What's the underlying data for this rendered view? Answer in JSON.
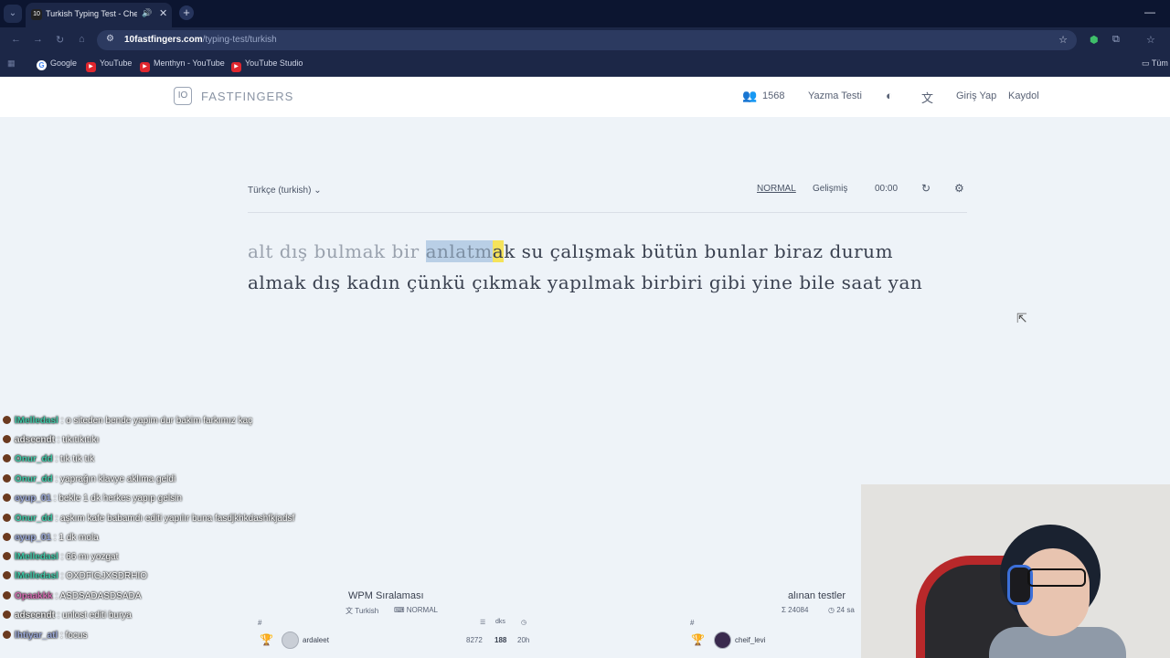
{
  "browser": {
    "tab_title": "Turkish Typing Test - Check",
    "url_host": "10fastfingers.com",
    "url_path": "/typing-test/turkish",
    "bookmarks": [
      "Google",
      "YouTube",
      "Menthyn - YouTube",
      "YouTube Studio",
      "Tüm"
    ]
  },
  "site": {
    "logo_text": "FASTFINGERS",
    "logo_mark": "IO",
    "online_count": "1568",
    "nav_typing_test": "Yazma Testi",
    "nav_login": "Giriş Yap",
    "nav_signup": "Kaydol"
  },
  "test": {
    "language": "Türkçe (turkish)",
    "mode_normal": "NORMAL",
    "mode_advanced": "Gelişmiş",
    "timer": "00:00",
    "line1_typed": "alt dış bulmak bir ",
    "current_word_typed": "anlatm",
    "current_word_caret": "a",
    "current_word_rest": "k",
    "line1_rest": " su çalışmak bütün bunlar biraz durum",
    "line2": "almak dış kadın çünkü çıkmak yapılmak birbiri gibi yine bile saat yan"
  },
  "chat": [
    {
      "nick": "lMelledasl",
      "text": " : o siteden bende yapim dur bakim farkımız kaç",
      "color": "#3ec9a7"
    },
    {
      "nick": "adsecndt",
      "text": " : tıkıtıkıtıkı",
      "color": "#e8e8e8"
    },
    {
      "nick": "Onur_dd",
      "text": " : tık tık tık",
      "color": "#3ec9a7"
    },
    {
      "nick": "Onur_dd",
      "text": " : yaprağın klavye aklıma geldi",
      "color": "#3ec9a7"
    },
    {
      "nick": "eyup_01",
      "text": " : bekle 1 dk herkes yapıp gelsin",
      "color": "#9aa8d8"
    },
    {
      "nick": "Onur_dd",
      "text": " : aşkım kafe babamdı editi yapılır buna fasdjkhkdashfkjadsf",
      "color": "#3ec9a7"
    },
    {
      "nick": "eyup_01",
      "text": " : 1 dk mola",
      "color": "#9aa8d8"
    },
    {
      "nick": "lMelledasl",
      "text": " : 66 mı yozgat",
      "color": "#3ec9a7"
    },
    {
      "nick": "lMelledasl",
      "text": " : OXDFIGJXSDRHIO",
      "color": "#3ec9a7"
    },
    {
      "nick": "Opaakkk",
      "text": " : ASDSADASDSADA",
      "color": "#d46bb0"
    },
    {
      "nick": "adsecndt",
      "text": " : unlost editi burya",
      "color": "#e8e8e8"
    },
    {
      "nick": "lhtiyar_atl",
      "text": " : focus",
      "color": "#9aa8d8"
    }
  ],
  "leaderboard_wpm": {
    "title": "WPM Sıralaması",
    "language": "Turkish",
    "mode": "NORMAL",
    "col_hash": "#",
    "col_dks": "dks",
    "row1": {
      "name": "ardaleet",
      "score": "8272",
      "wpm": "188",
      "time": "20h"
    }
  },
  "leaderboard_tests": {
    "title": "alınan testler",
    "total": "24084",
    "time": "24 sa",
    "col_hash": "#",
    "row1": {
      "name": "cheif_levi"
    }
  }
}
